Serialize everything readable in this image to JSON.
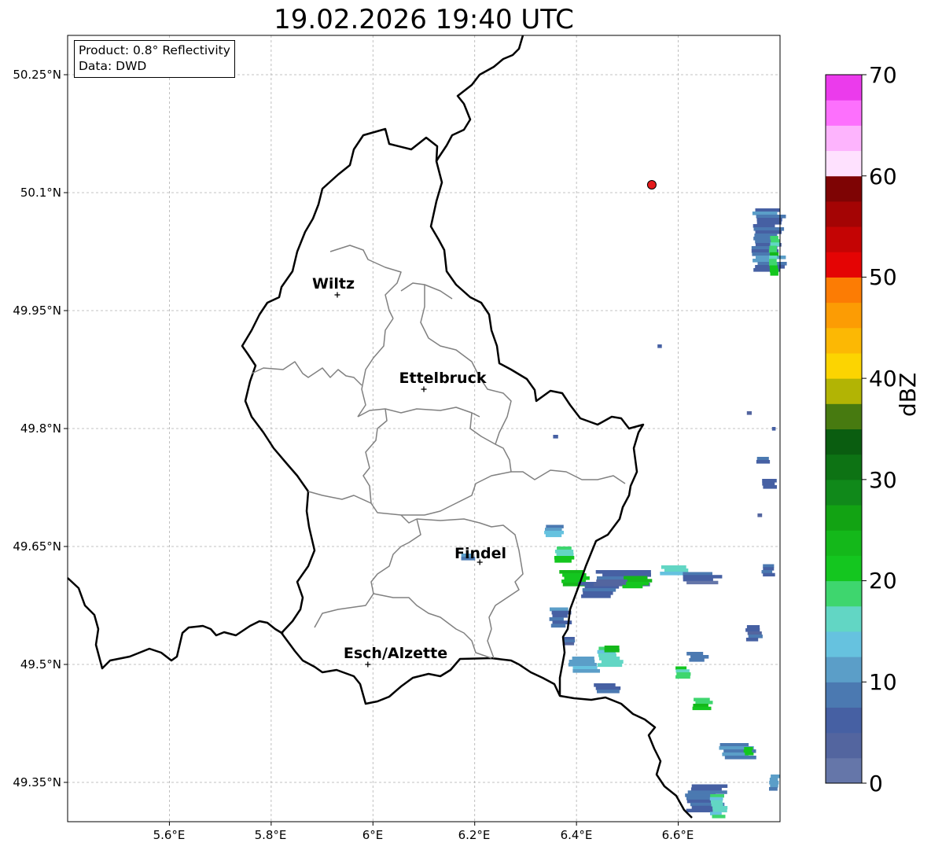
{
  "title": "19.02.2026 19:40 UTC",
  "info": {
    "product": "Product: 0.8° Reflectivity",
    "data": "Data: DWD"
  },
  "lat_ticks": [
    "50.25°N",
    "50.1°N",
    "49.95°N",
    "49.8°N",
    "49.65°N",
    "49.5°N",
    "49.35°N"
  ],
  "lon_ticks": [
    "5.6°E",
    "5.8°E",
    "6°E",
    "6.2°E",
    "6.4°E",
    "6.6°E"
  ],
  "extent": {
    "lon": [
      5.4,
      6.8
    ],
    "lat": [
      49.3,
      50.3
    ]
  },
  "cities": [
    {
      "name": "Wiltz",
      "lon": 5.93,
      "lat": 49.97
    },
    {
      "name": "Ettelbruck",
      "lon": 6.1,
      "lat": 49.85
    },
    {
      "name": "Findel",
      "lon": 6.21,
      "lat": 49.63
    },
    {
      "name": "Esch/Alzette",
      "lon": 5.99,
      "lat": 49.5
    }
  ],
  "radar_site": {
    "lon": 6.548,
    "lat": 50.11,
    "color": "#e41a1c"
  },
  "colorbar": {
    "label": "dBZ",
    "min": 0,
    "max": 70,
    "ticks": [
      "0",
      "10",
      "20",
      "30",
      "40",
      "50",
      "60",
      "70"
    ],
    "colors": [
      "#6576a9",
      "#53659f",
      "#4660a3",
      "#4b79b1",
      "#5b9ec8",
      "#66c2df",
      "#62d6c4",
      "#3ed66e",
      "#14c61f",
      "#14b81a",
      "#12a313",
      "#10891a",
      "#0d7314",
      "#0a5d10",
      "#477a10",
      "#b2b404",
      "#fcd401",
      "#fcb804",
      "#fc9c04",
      "#fc7c04",
      "#e40404",
      "#c40404",
      "#a40404",
      "#7e0404",
      "#fee1fe",
      "#fdb4fd",
      "#fd70fd",
      "#eb3bec"
    ]
  },
  "colors": {
    "border": "#000000",
    "canton": "#808080",
    "grid": "#b0b0b0"
  },
  "echoes": [
    {
      "lon": 6.36,
      "lat": 49.67,
      "w": 0.04,
      "h": 0.015,
      "dbz": 12
    },
    {
      "lon": 6.38,
      "lat": 49.64,
      "w": 0.04,
      "h": 0.02,
      "dbz": 18
    },
    {
      "lon": 6.4,
      "lat": 49.61,
      "w": 0.06,
      "h": 0.02,
      "dbz": 24
    },
    {
      "lon": 6.45,
      "lat": 49.595,
      "w": 0.08,
      "h": 0.02,
      "dbz": 8
    },
    {
      "lon": 6.5,
      "lat": 49.61,
      "w": 0.12,
      "h": 0.02,
      "dbz": 6
    },
    {
      "lon": 6.52,
      "lat": 49.605,
      "w": 0.05,
      "h": 0.015,
      "dbz": 22
    },
    {
      "lon": 6.6,
      "lat": 49.62,
      "w": 0.06,
      "h": 0.012,
      "dbz": 14
    },
    {
      "lon": 6.65,
      "lat": 49.61,
      "w": 0.08,
      "h": 0.015,
      "dbz": 5
    },
    {
      "lon": 6.37,
      "lat": 49.56,
      "w": 0.04,
      "h": 0.025,
      "dbz": 9
    },
    {
      "lon": 6.39,
      "lat": 49.53,
      "w": 0.03,
      "h": 0.01,
      "dbz": 6
    },
    {
      "lon": 6.42,
      "lat": 49.5,
      "w": 0.06,
      "h": 0.02,
      "dbz": 12
    },
    {
      "lon": 6.47,
      "lat": 49.51,
      "w": 0.05,
      "h": 0.025,
      "dbz": 16
    },
    {
      "lon": 6.47,
      "lat": 49.52,
      "w": 0.03,
      "h": 0.008,
      "dbz": 22
    },
    {
      "lon": 6.46,
      "lat": 49.47,
      "w": 0.05,
      "h": 0.012,
      "dbz": 6
    },
    {
      "lon": 6.61,
      "lat": 49.49,
      "w": 0.03,
      "h": 0.015,
      "dbz": 18
    },
    {
      "lon": 6.64,
      "lat": 49.51,
      "w": 0.04,
      "h": 0.012,
      "dbz": 10
    },
    {
      "lon": 6.65,
      "lat": 49.45,
      "w": 0.04,
      "h": 0.015,
      "dbz": 22
    },
    {
      "lon": 6.66,
      "lat": 49.33,
      "w": 0.08,
      "h": 0.035,
      "dbz": 8
    },
    {
      "lon": 6.68,
      "lat": 49.32,
      "w": 0.03,
      "h": 0.03,
      "dbz": 16
    },
    {
      "lon": 6.72,
      "lat": 49.39,
      "w": 0.07,
      "h": 0.02,
      "dbz": 10
    },
    {
      "lon": 6.74,
      "lat": 49.39,
      "w": 0.02,
      "h": 0.01,
      "dbz": 20
    },
    {
      "lon": 6.78,
      "lat": 50.04,
      "w": 0.06,
      "h": 0.08,
      "dbz": 8
    },
    {
      "lon": 6.79,
      "lat": 50.02,
      "w": 0.02,
      "h": 0.05,
      "dbz": 20
    },
    {
      "lon": 6.77,
      "lat": 49.76,
      "w": 0.03,
      "h": 0.008,
      "dbz": 6
    },
    {
      "lon": 6.78,
      "lat": 49.73,
      "w": 0.03,
      "h": 0.012,
      "dbz": 9
    },
    {
      "lon": 6.78,
      "lat": 49.62,
      "w": 0.03,
      "h": 0.015,
      "dbz": 8
    },
    {
      "lon": 6.75,
      "lat": 49.54,
      "w": 0.03,
      "h": 0.02,
      "dbz": 6
    },
    {
      "lon": 6.79,
      "lat": 49.35,
      "w": 0.02,
      "h": 0.02,
      "dbz": 10
    },
    {
      "lon": 6.565,
      "lat": 49.905,
      "w": 0.01,
      "h": 0.004,
      "dbz": 8
    },
    {
      "lon": 6.36,
      "lat": 49.79,
      "w": 0.01,
      "h": 0.004,
      "dbz": 5
    },
    {
      "lon": 6.19,
      "lat": 49.637,
      "w": 0.03,
      "h": 0.008,
      "dbz": 8
    },
    {
      "lon": 6.74,
      "lat": 49.82,
      "w": 0.01,
      "h": 0.004,
      "dbz": 6
    },
    {
      "lon": 6.79,
      "lat": 49.8,
      "w": 0.01,
      "h": 0.004,
      "dbz": 6
    },
    {
      "lon": 6.76,
      "lat": 49.69,
      "w": 0.01,
      "h": 0.004,
      "dbz": 6
    }
  ]
}
